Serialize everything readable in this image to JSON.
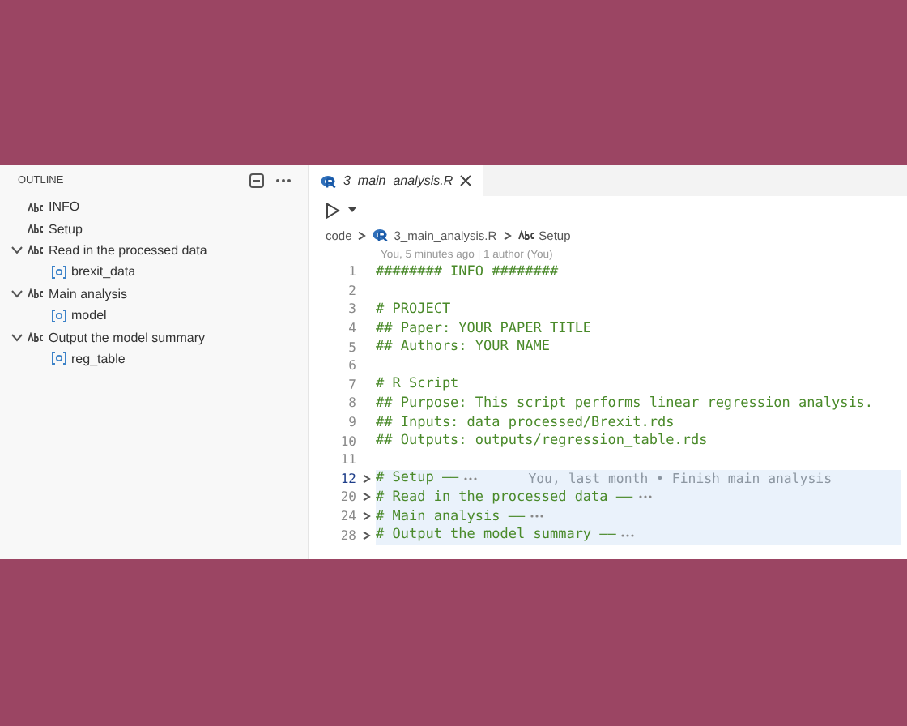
{
  "outline": {
    "title": "OUTLINE",
    "items": [
      {
        "label": "INFO",
        "kind": "string"
      },
      {
        "label": "Setup",
        "kind": "string"
      },
      {
        "label": "Read in the processed data",
        "kind": "string",
        "expanded": true,
        "children": [
          {
            "label": "brexit_data",
            "kind": "variable"
          }
        ]
      },
      {
        "label": "Main analysis",
        "kind": "string",
        "expanded": true,
        "children": [
          {
            "label": "model",
            "kind": "variable"
          }
        ]
      },
      {
        "label": "Output the model summary",
        "kind": "string",
        "expanded": true,
        "children": [
          {
            "label": "reg_table",
            "kind": "variable"
          }
        ]
      }
    ]
  },
  "tabs": [
    {
      "label": "3_main_analysis.R",
      "selected": true
    }
  ],
  "breadcrumb": [
    {
      "label": "code",
      "kind": "folder"
    },
    {
      "label": "3_main_analysis.R",
      "kind": "file"
    },
    {
      "label": "Setup",
      "kind": "string"
    }
  ],
  "blame_header": "You, 5 minutes ago | 1 author (You)",
  "code_lines": [
    {
      "number": "1",
      "text": "######## INFO ########",
      "folded": false,
      "current": false
    },
    {
      "number": "2",
      "folded": false,
      "current": false
    },
    {
      "number": "3",
      "text": "# PROJECT",
      "folded": false,
      "current": false
    },
    {
      "number": "4",
      "text": "## Paper: YOUR PAPER TITLE",
      "folded": false,
      "current": false
    },
    {
      "number": "5",
      "text": "## Authors: YOUR NAME",
      "folded": false,
      "current": false
    },
    {
      "number": "6",
      "folded": false,
      "current": false
    },
    {
      "number": "7",
      "text": "# R Script",
      "folded": false,
      "current": false
    },
    {
      "number": "8",
      "text": "## Purpose: This script performs linear regression analysis.",
      "folded": false,
      "current": false
    },
    {
      "number": "9",
      "text": "## Inputs: data_processed/Brexit.rds",
      "folded": false,
      "current": false
    },
    {
      "number": "10",
      "text": "## Outputs: outputs/regression_table.rds",
      "folded": false,
      "current": false
    },
    {
      "number": "11",
      "folded": false,
      "current": false
    },
    {
      "number": "12",
      "text": "# Setup ——",
      "folded": true,
      "current": true,
      "blame": "You, last month • Finish main analysis"
    },
    {
      "number": "20",
      "text": "# Read in the processed data ——",
      "folded": true,
      "current": false
    },
    {
      "number": "24",
      "text": "# Main analysis ——",
      "folded": true,
      "current": false
    },
    {
      "number": "28",
      "text": "# Output the model summary ——",
      "folded": true,
      "current": false
    }
  ]
}
